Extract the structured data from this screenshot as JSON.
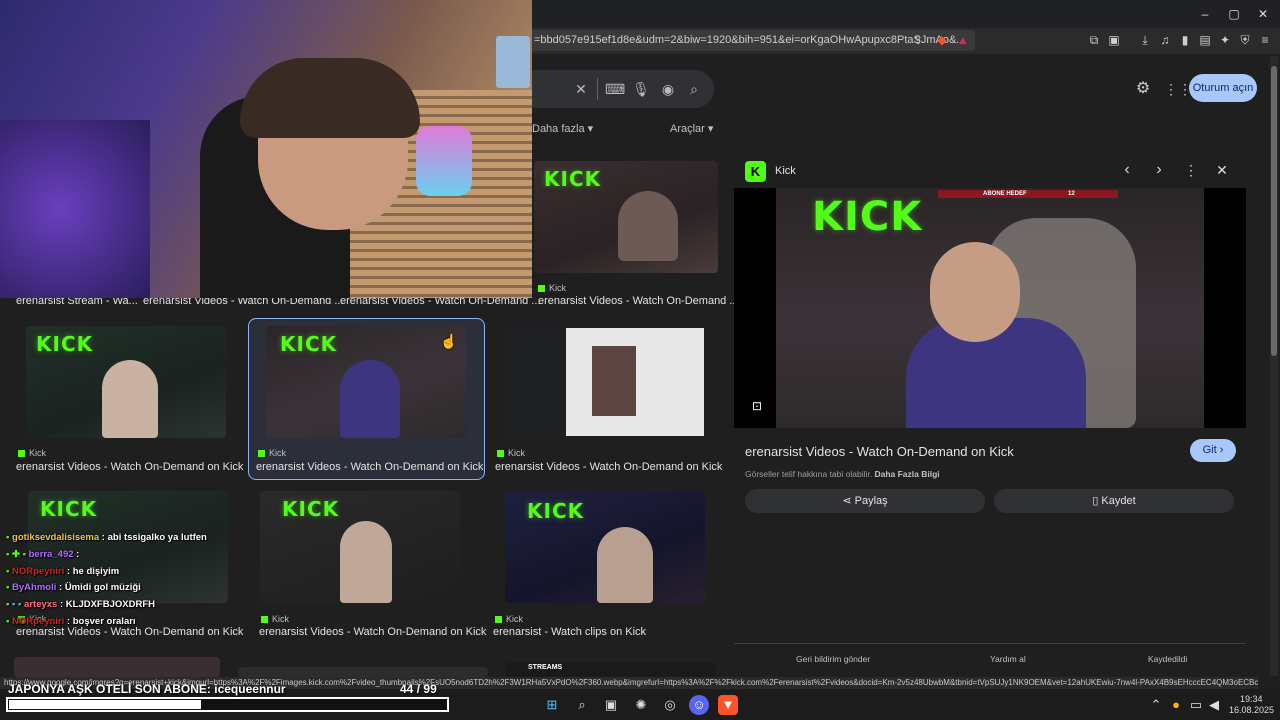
{
  "browser": {
    "url": "=bbd057e915ef1d8e&udm=2&biw=1920&bih=951&ei=orKgaOHwApupxc8PtaSJmAo&...",
    "window_controls": [
      "–",
      "▢",
      "✕"
    ]
  },
  "google": {
    "filters": {
      "more": "Daha fazla",
      "tools": "Araçlar"
    },
    "signin_label": "Oturum açın"
  },
  "grid": {
    "row1": [
      {
        "title": "erenarsist Stream - Wa..."
      },
      {
        "title": "erenarsist Videos - Watch On-Demand ..."
      },
      {
        "title": "erenarsist Videos - Watch On-Demand ..."
      },
      {
        "source": "Kick",
        "title": "erenarsist Videos - Watch On-Demand ..."
      }
    ],
    "row2": [
      {
        "source": "Kick",
        "title": "erenarsist Videos - Watch On-Demand on Kick"
      },
      {
        "source": "Kick",
        "title": "erenarsist Videos - Watch On-Demand on Kick"
      },
      {
        "source": "Kick",
        "title": "erenarsist Videos - Watch On-Demand on Kick"
      }
    ],
    "row3": [
      {
        "source": "Kick",
        "title": "erenarsist Videos - Watch On-Demand on Kick"
      },
      {
        "source": "Kick",
        "title": "erenarsist Videos - Watch On-Demand on Kick"
      },
      {
        "source": "Kick",
        "title": "erenarsist - Watch clips on Kick"
      }
    ],
    "row4_label": "STREAMS",
    "kick_logo": "KICK"
  },
  "preview": {
    "source": "Kick",
    "title": "erenarsist Videos - Watch On-Demand on Kick",
    "go_label": "Git",
    "notice": "Görseller telif hakkına tabi olabilir.",
    "notice_link": "Daha Fazla Bilgi",
    "share_label": "Paylaş",
    "save_label": "Kaydet",
    "overlay_label": "ABONE HEDEF",
    "overlay_count": "12",
    "footer": {
      "feedback": "Geri bildirim gönder",
      "help": "Yardım al",
      "saved": "Kaydedildi"
    }
  },
  "chat": [
    {
      "user": "gotiksevdalisisema",
      "msg": "abi tssigalko ya lutfen",
      "color": "#f5c542"
    },
    {
      "user": "berra_492",
      "msg": "",
      "color": "#b26bff"
    },
    {
      "user": "NORpeyniri",
      "msg": "he dişiyim",
      "color": "#d92020"
    },
    {
      "user": "ByAhmoli",
      "msg": "Ümidi gol müziği",
      "color": "#b26bff"
    },
    {
      "user": "arteyxs",
      "msg": "KLJDXFBJOXDRFH",
      "color": "#ff6b81"
    },
    {
      "user": "NORpeyniri",
      "msg": "boşver oraları",
      "color": "#d92020"
    }
  ],
  "status_url": "https://www.google.com/imgres?q=erenarsist+kick&imgurl=https%3A%2F%2Fimages.kick.com%2Fvideo_thumbnails%2FsUO5nod6TD2h%2F3W1RHa5VxPdO%2F360.webp&imgrefurl=https%3A%2F%2Fkick.com%2Ferenarsist%2Fvideos&docid=Km-2v5z48UbwbM&tbnid=tVpSUJy1NK9OEM&vet=12ahUKEwiu-7nw4l-PAxX4B9sEHcccEC4QM3oECBcQAA...",
  "stream_overlay": {
    "subs_text": "JAPONYA AŞK OTELİ SON ABONE: icequeennur",
    "goal_current": "44",
    "goal_sep": "/",
    "goal_total": "99",
    "goal_fraction": 0.44
  },
  "system": {
    "time": "19:34",
    "date": "16.08.2025"
  }
}
